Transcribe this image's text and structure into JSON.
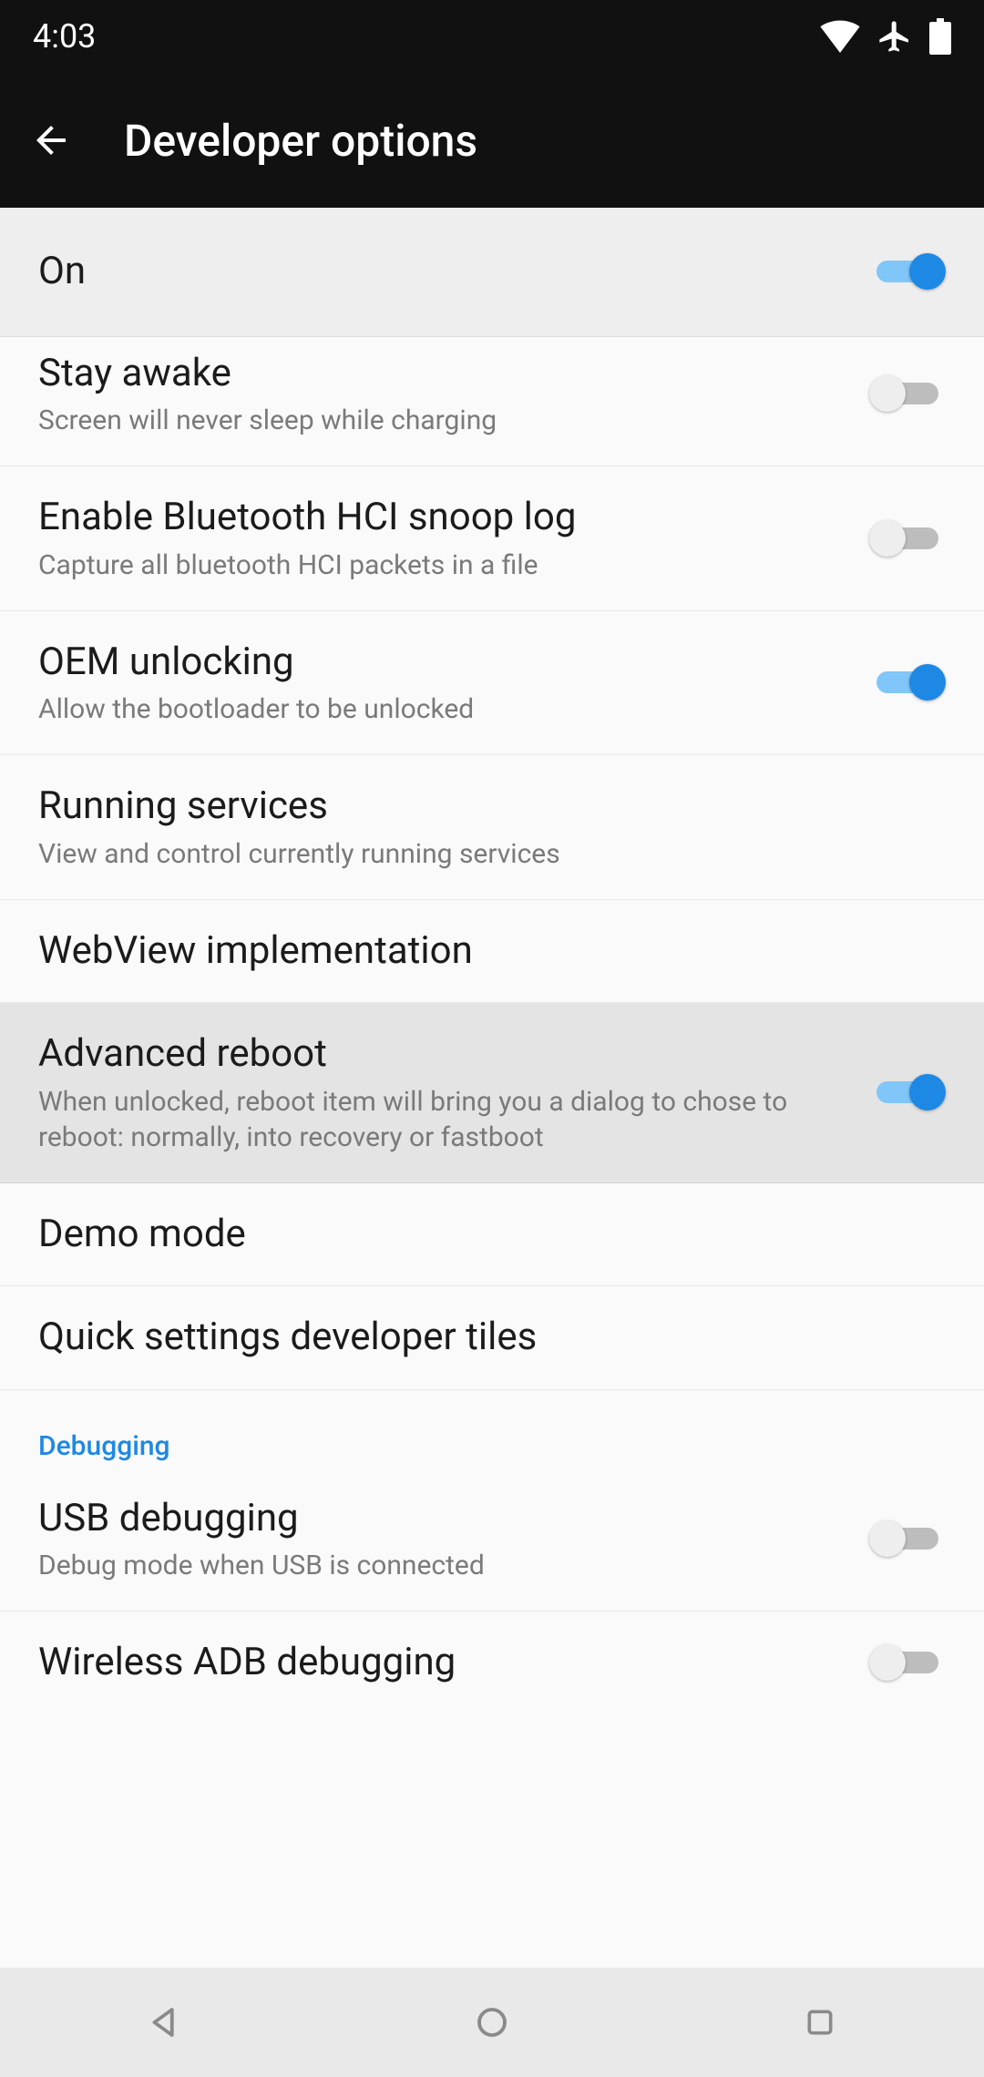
{
  "status": {
    "time": "4:03"
  },
  "appbar": {
    "title": "Developer options"
  },
  "master": {
    "label": "On",
    "on": true
  },
  "rows": [
    {
      "title": "Stay awake",
      "subtitle": "Screen will never sleep while charging",
      "toggle": true,
      "on": false
    },
    {
      "title": "Enable Bluetooth HCI snoop log",
      "subtitle": "Capture all bluetooth HCI packets in a file",
      "toggle": true,
      "on": false
    },
    {
      "title": "OEM unlocking",
      "subtitle": "Allow the bootloader to be unlocked",
      "toggle": true,
      "on": true
    },
    {
      "title": "Running services",
      "subtitle": "View and control currently running services",
      "toggle": false
    },
    {
      "title": "WebView implementation",
      "subtitle": "",
      "toggle": false
    },
    {
      "title": "Advanced reboot",
      "subtitle": "When unlocked, reboot item will bring you a dialog to chose to reboot: normally, into recovery or fastboot",
      "toggle": true,
      "on": true,
      "highlight": true
    },
    {
      "title": "Demo mode",
      "subtitle": "",
      "toggle": false
    },
    {
      "title": "Quick settings developer tiles",
      "subtitle": "",
      "toggle": false
    }
  ],
  "section": {
    "label": "Debugging"
  },
  "rows2": [
    {
      "title": "USB debugging",
      "subtitle": "Debug mode when USB is connected",
      "toggle": true,
      "on": false
    },
    {
      "title": "Wireless ADB debugging",
      "subtitle": "",
      "toggle": true,
      "on": false
    }
  ]
}
